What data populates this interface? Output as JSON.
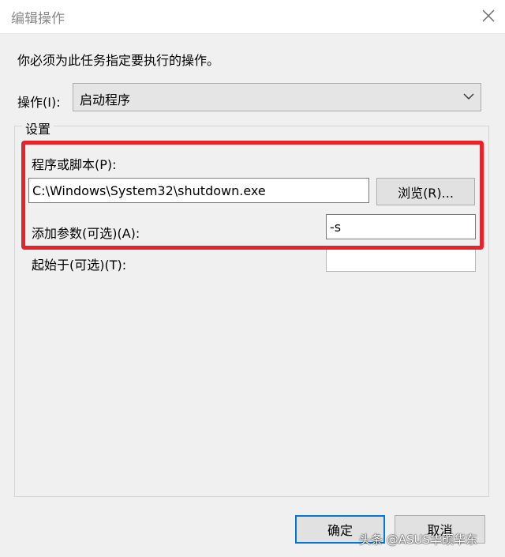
{
  "window": {
    "title": "编辑操作"
  },
  "instruction": "你必须为此任务指定要执行的操作。",
  "action": {
    "label": "操作(I):",
    "selected": "启动程序"
  },
  "settings": {
    "legend": "设置",
    "program_label": "程序或脚本(P):",
    "program_value": "C:\\Windows\\System32\\shutdown.exe",
    "browse_label": "浏览(R)...",
    "args_label": "添加参数(可选)(A):",
    "args_value": "-s",
    "start_in_label": "起始于(可选)(T):",
    "start_in_value": ""
  },
  "buttons": {
    "ok": "确定",
    "cancel": "取消"
  },
  "watermark": "头条 @ASUS华硕华东",
  "colors": {
    "highlight": "#e5232b",
    "focus": "#0078d7"
  }
}
